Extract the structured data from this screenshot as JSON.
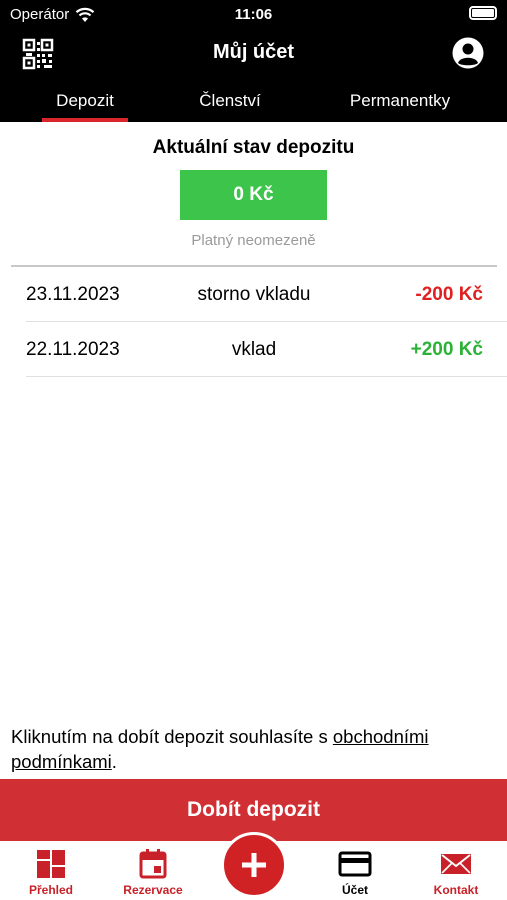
{
  "status_bar": {
    "carrier": "Operátor",
    "time": "11:06"
  },
  "header": {
    "title": "Můj účet",
    "left_icon": "qr-code-icon",
    "right_icon": "user-circle-icon"
  },
  "tabs": [
    {
      "label": "Depozit",
      "active": true
    },
    {
      "label": "Členství",
      "active": false
    },
    {
      "label": "Permanentky",
      "active": false
    }
  ],
  "deposit": {
    "title": "Aktuální stav depozitu",
    "balance": "0 Kč",
    "validity": "Platný neomezeně"
  },
  "transactions": [
    {
      "date": "23.11.2023",
      "description": "storno vkladu",
      "amount": "-200 Kč",
      "type": "negative"
    },
    {
      "date": "22.11.2023",
      "description": "vklad",
      "amount": "+200 Kč",
      "type": "positive"
    }
  ],
  "terms": {
    "text": "Kliknutím na dobít depozit souhlasíte s ",
    "link": "obchodními podmínkami",
    "suffix": "."
  },
  "topup_button": "Dobít depozit",
  "tabbar": {
    "items": [
      {
        "label": "Přehled",
        "icon": "dashboard-icon"
      },
      {
        "label": "Rezervace",
        "icon": "calendar-icon"
      },
      {
        "label": "",
        "icon": "plus-icon"
      },
      {
        "label": "Účet",
        "icon": "credit-card-icon"
      },
      {
        "label": "Kontakt",
        "icon": "envelope-icon"
      }
    ]
  },
  "colors": {
    "accent_red": "#d02f33",
    "balance_green": "#3dc44b",
    "negative": "#e02020",
    "positive": "#2bb236"
  }
}
